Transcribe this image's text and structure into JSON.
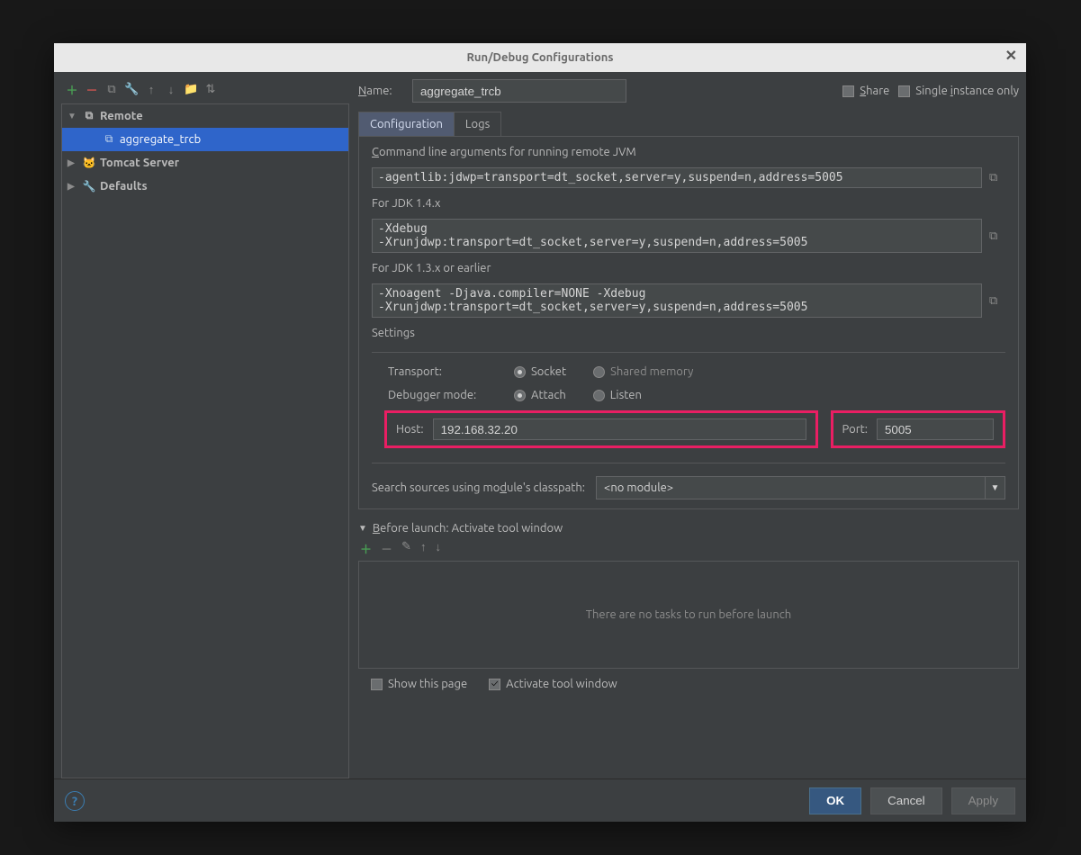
{
  "title": "Run/Debug Configurations",
  "toolbar_icons": [
    "add",
    "remove",
    "copy",
    "wrench",
    "up",
    "down",
    "folder",
    "sort"
  ],
  "tree": {
    "remote": {
      "label": "Remote",
      "child": "aggregate_trcb"
    },
    "tomcat": {
      "label": "Tomcat Server"
    },
    "defaults": {
      "label": "Defaults"
    }
  },
  "name": {
    "label": "Name:",
    "value": "aggregate_trcb"
  },
  "share": "Share",
  "single_instance": "Single instance only",
  "tabs": {
    "config": "Configuration",
    "logs": "Logs"
  },
  "cmd1_label": "Command line arguments for running remote JVM",
  "cmd1": "-agentlib:jdwp=transport=dt_socket,server=y,suspend=n,address=5005",
  "cmd2_label": "For JDK 1.4.x",
  "cmd2": "-Xdebug\n-Xrunjdwp:transport=dt_socket,server=y,suspend=n,address=5005",
  "cmd3_label": "For JDK 1.3.x or earlier",
  "cmd3": "-Xnoagent -Djava.compiler=NONE -Xdebug\n-Xrunjdwp:transport=dt_socket,server=y,suspend=n,address=5005",
  "settings_title": "Settings",
  "settings": {
    "transport_label": "Transport:",
    "transport_socket": "Socket",
    "transport_shared": "Shared memory",
    "debugger_label": "Debugger mode:",
    "debugger_attach": "Attach",
    "debugger_listen": "Listen",
    "host_label": "Host:",
    "host_value": "192.168.32.20",
    "port_label": "Port:",
    "port_value": "5005"
  },
  "search_sources_label": "Search sources using module's classpath:",
  "search_sources_value": "<no module>",
  "before_launch": {
    "header": "Before launch: Activate tool window",
    "empty": "There are no tasks to run before launch"
  },
  "bottom": {
    "show_page": "Show this page",
    "activate_window": "Activate tool window"
  },
  "buttons": {
    "ok": "OK",
    "cancel": "Cancel",
    "apply": "Apply"
  }
}
